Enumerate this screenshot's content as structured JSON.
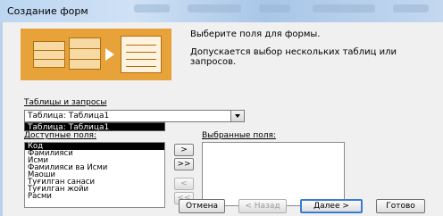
{
  "window": {
    "title": "Создание форм"
  },
  "intro": {
    "line1": "Выберите поля для формы.",
    "line2": "Допускается выбор нескольких таблиц или запросов."
  },
  "tables": {
    "label": "Таблицы и запросы",
    "selected": "Таблица: Таблица1",
    "dropdown_item": "Таблица: Таблица1"
  },
  "available": {
    "label": "Доступные поля:",
    "items": [
      "Код",
      "Фамилияси",
      "Исми",
      "Фамилияси ва Исми",
      "Маоши",
      "Туғилган санаси",
      "Туғилган жойи",
      "Расми"
    ]
  },
  "selected_fields": {
    "label": "Выбранные поля:"
  },
  "move_buttons": {
    "add_one": ">",
    "add_all": ">>",
    "remove_one": "<",
    "remove_all": "<<"
  },
  "footer": {
    "cancel": "Отмена",
    "back": "< Назад",
    "next": "Далее >",
    "finish": "Готово"
  }
}
